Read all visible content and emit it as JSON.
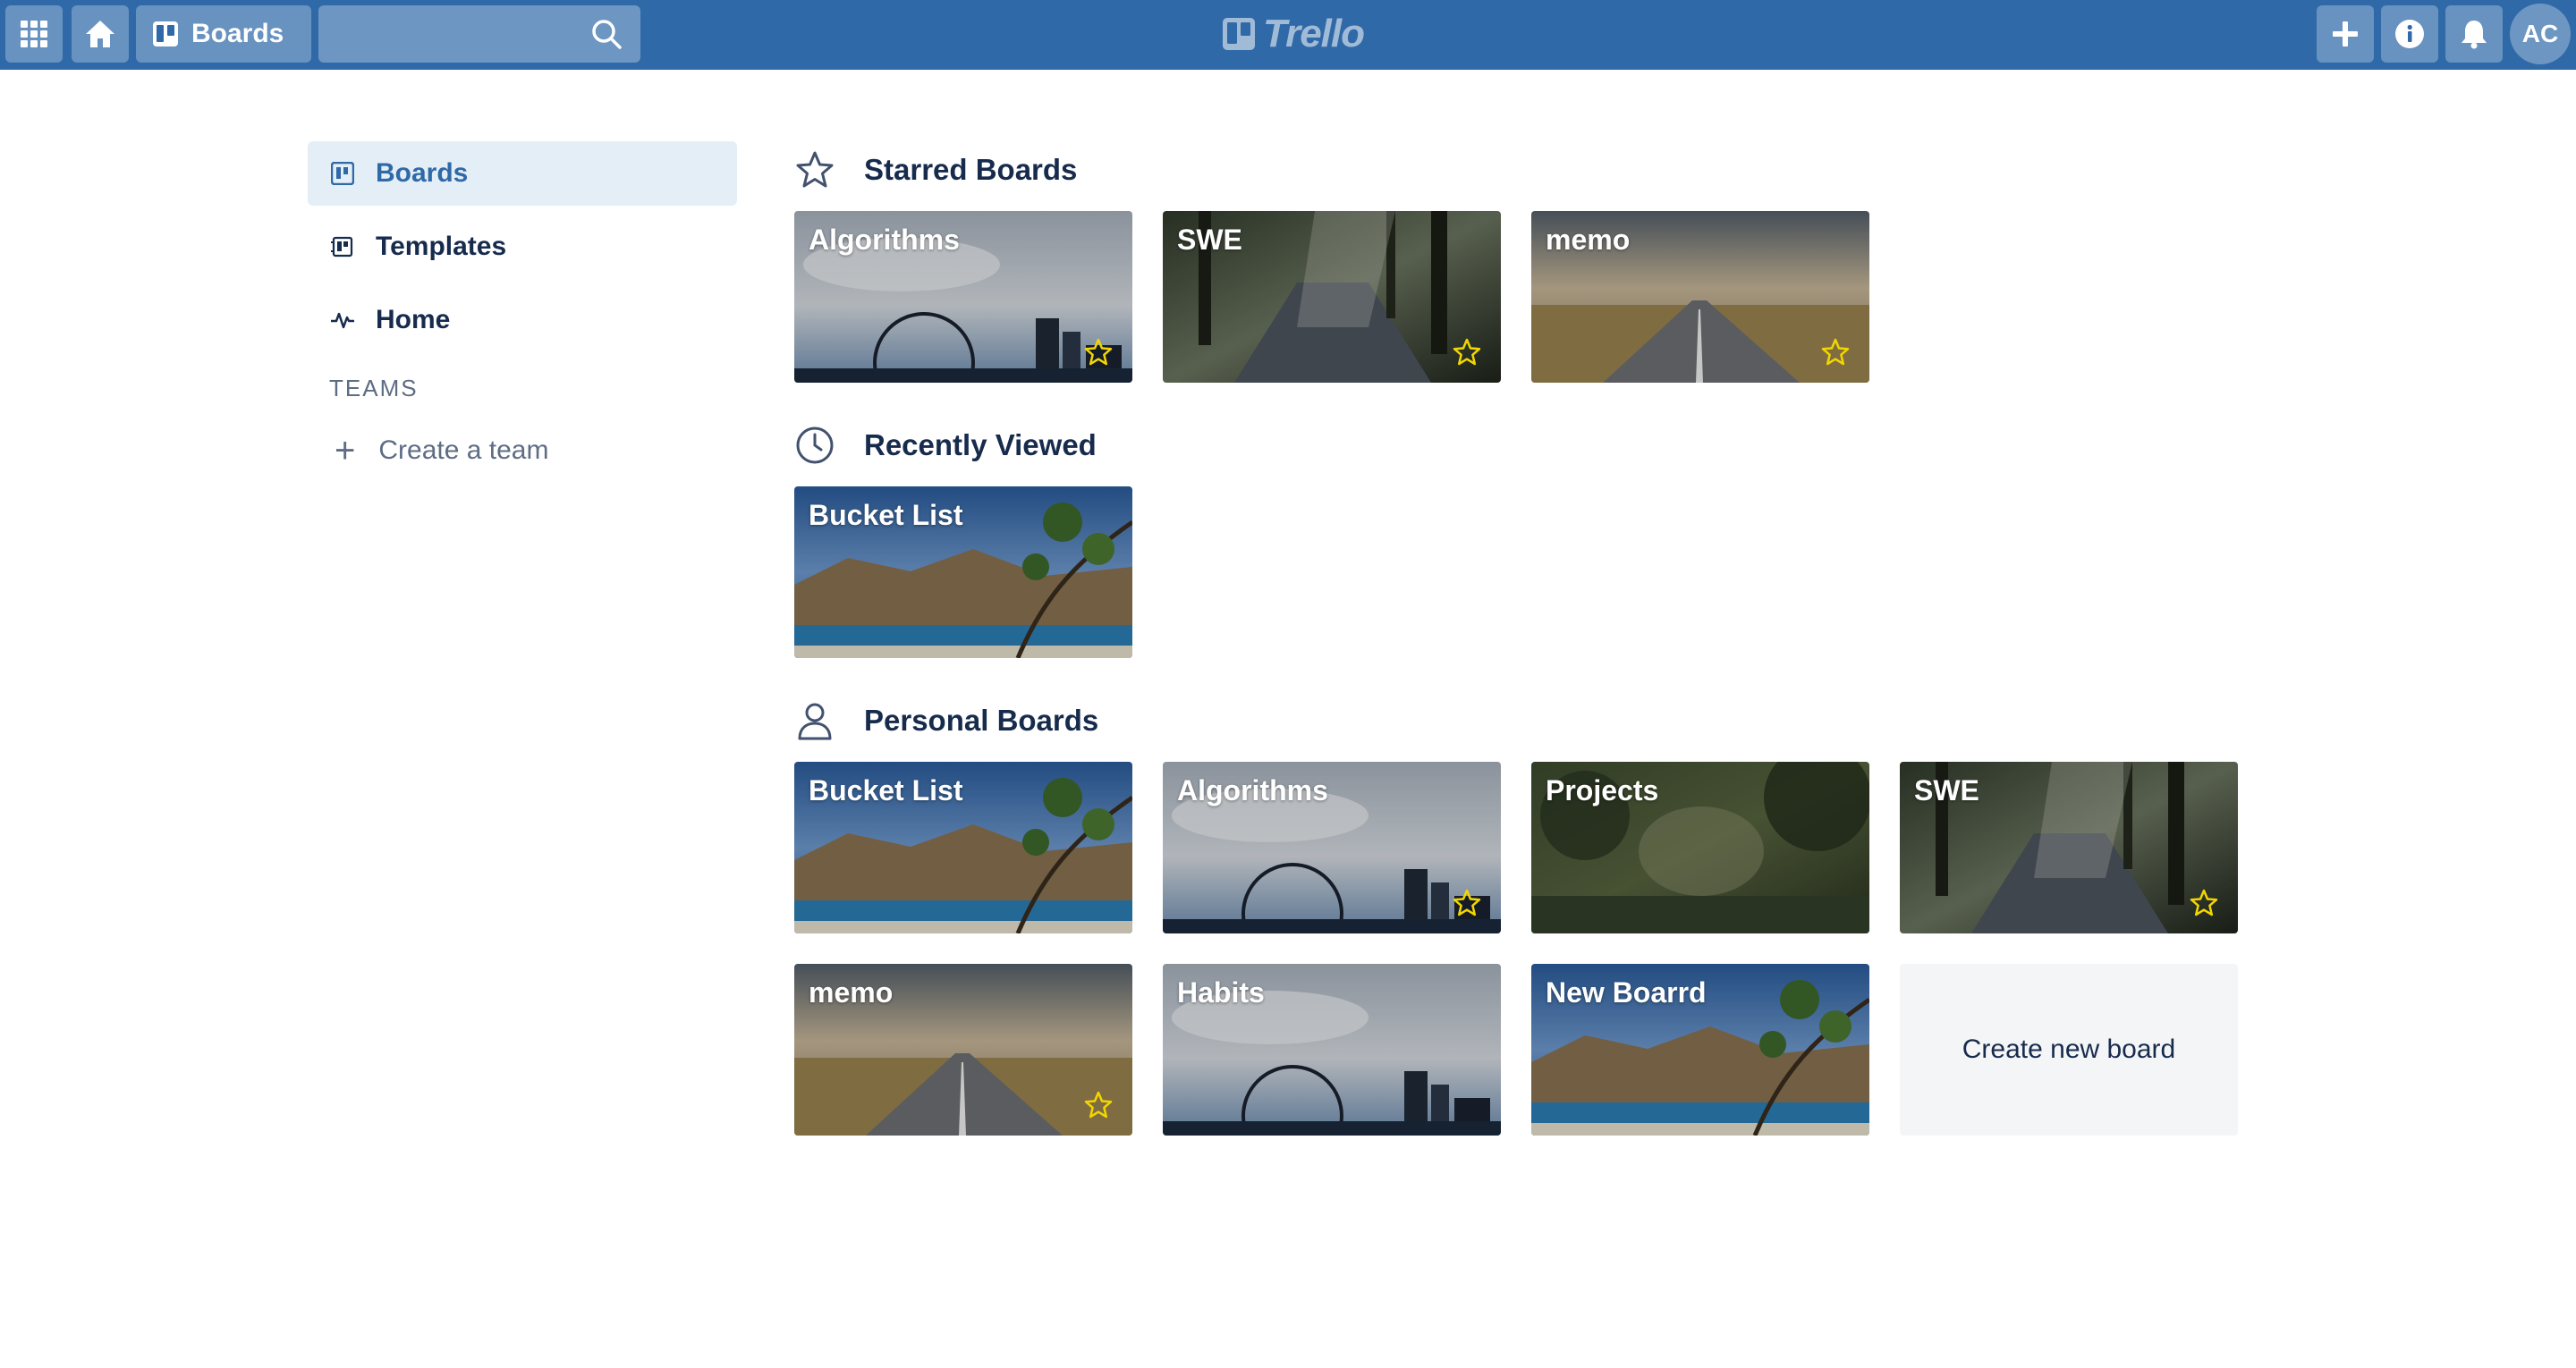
{
  "header": {
    "boards_label": "Boards",
    "search_placeholder": "",
    "logo_text": "Trello",
    "avatar_initials": "AC",
    "color": "#2f69a8"
  },
  "sidebar": {
    "items": [
      {
        "label": "Boards",
        "icon": "board-icon",
        "active": true
      },
      {
        "label": "Templates",
        "icon": "template-icon",
        "active": false
      },
      {
        "label": "Home",
        "icon": "activity-icon",
        "active": false
      }
    ],
    "teams_heading": "TEAMS",
    "create_team_label": "Create a team"
  },
  "sections": {
    "starred": {
      "title": "Starred Boards",
      "icon": "star-outline-icon",
      "boards": [
        {
          "name": "Algorithms",
          "background": "city-ferris-wheel",
          "starred": true
        },
        {
          "name": "SWE",
          "background": "forest-path",
          "starred": true
        },
        {
          "name": "memo",
          "background": "open-road",
          "starred": true
        }
      ]
    },
    "recent": {
      "title": "Recently Viewed",
      "icon": "clock-icon",
      "boards": [
        {
          "name": "Bucket List",
          "background": "mountain-lake",
          "starred": false
        }
      ]
    },
    "personal": {
      "title": "Personal Boards",
      "icon": "person-icon",
      "boards": [
        {
          "name": "Bucket List",
          "background": "mountain-lake",
          "starred": false
        },
        {
          "name": "Algorithms",
          "background": "city-ferris-wheel",
          "starred": true
        },
        {
          "name": "Projects",
          "background": "jungle",
          "starred": false
        },
        {
          "name": "SWE",
          "background": "forest-path",
          "starred": true
        },
        {
          "name": "memo",
          "background": "open-road",
          "starred": true
        },
        {
          "name": "Habits",
          "background": "city-ferris-wheel",
          "starred": false
        },
        {
          "name": "New Boarrd",
          "background": "mountain-lake",
          "starred": false
        }
      ],
      "create_label": "Create new board"
    }
  },
  "colors": {
    "accent": "#2f69a8",
    "star": "#f2d600",
    "sidebar_active_bg": "#e4eef6"
  }
}
